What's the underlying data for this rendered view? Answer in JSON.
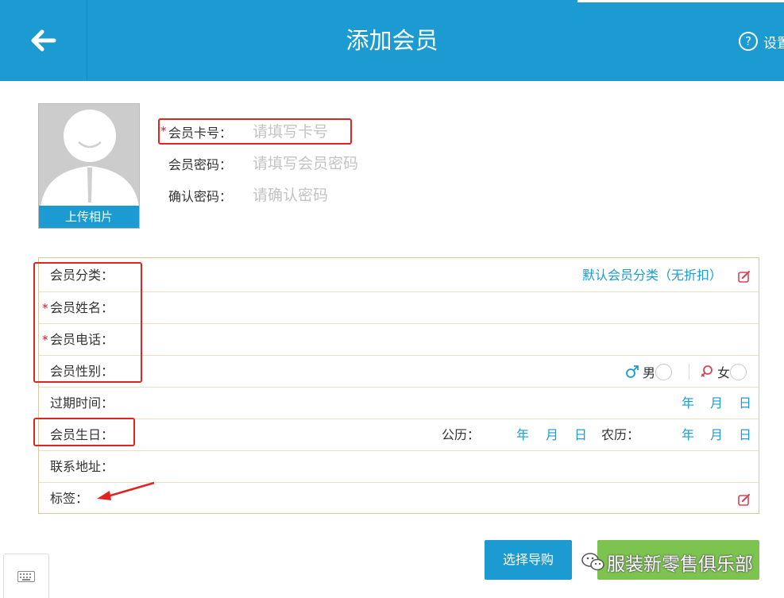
{
  "header": {
    "title": "添加会员",
    "settings_label": "设置",
    "settings_icon_glyph": "?",
    "back_icon": "arrow-left-icon",
    "color": "#1b9bd1"
  },
  "avatar": {
    "upload_label": "上传相片",
    "icon": "user-silhouette-icon"
  },
  "required_mark": "*",
  "fields": {
    "card_no": {
      "label": "会员卡号：",
      "placeholder": "请填写卡号",
      "value": ""
    },
    "password": {
      "label": "会员密码：",
      "placeholder": "请填写会员密码",
      "value": ""
    },
    "confirm": {
      "label": "确认密码：",
      "placeholder": "请确认密码",
      "value": ""
    }
  },
  "form": {
    "category": {
      "label": "会员分类：",
      "value": "默认会员分类（无折扣）"
    },
    "name": {
      "label": "会员姓名："
    },
    "phone": {
      "label": "会员电话："
    },
    "gender": {
      "label": "会员性别：",
      "male": "男",
      "female": "女",
      "male_icon": "male-symbol-icon",
      "female_icon": "female-symbol-icon"
    },
    "expire": {
      "label": "过期时间：",
      "year": "年",
      "month": "月",
      "day": "日"
    },
    "birthday": {
      "label": "会员生日：",
      "solar": "公历：",
      "lunar": "农历：",
      "year": "年",
      "month": "月",
      "day": "日"
    },
    "address": {
      "label": "联系地址："
    },
    "tags": {
      "label": "标签："
    }
  },
  "buttons": {
    "guide": "选择导购"
  },
  "watermark": {
    "text": "服装新零售俱乐部",
    "icon": "wechat-icon"
  },
  "colors": {
    "accent": "#1b9bd1",
    "required": "#c8232c",
    "annotation": "#e02420",
    "confirm_green": "#7cc44f"
  }
}
